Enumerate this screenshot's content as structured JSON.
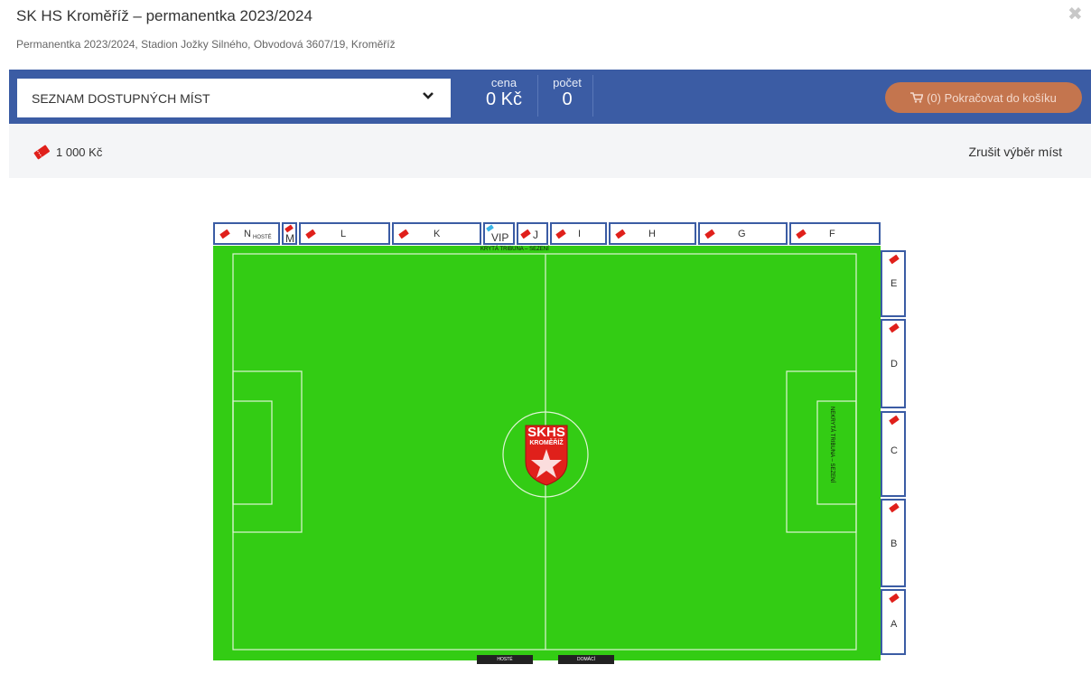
{
  "header": {
    "title": "SK HS Kroměříž – permanentka 2023/2024",
    "subtitle": "Permanentka 2023/2024, Stadion Jožky Silného, Obvodová 3607/19, Kroměříž",
    "close_icon": "close-icon"
  },
  "toolbar": {
    "select_value": "SEZNAM DOSTUPNÝCH MÍST",
    "price_label": "cena",
    "price_value": "0 Kč",
    "count_label": "počet",
    "count_value": "0",
    "cart_label": "(0) Pokračovat do košíku",
    "accent": "#3b5ca4",
    "cart_color": "#c4754e"
  },
  "price_strip": {
    "price": "1 000 Kč",
    "cancel_label": "Zrušit výběr míst",
    "ticket_color": "#e0201b"
  },
  "stadium": {
    "top_sectors": [
      "N",
      "M",
      "L",
      "K",
      "VIP",
      "J",
      "I",
      "H",
      "G",
      "F"
    ],
    "n_sub": "HOSTÉ",
    "right_sectors": [
      "E",
      "D",
      "C",
      "B",
      "A"
    ],
    "top_stand": "KRYTÁ TRIBUNA – SEZENÍ",
    "right_stand": "NEKRYTÁ TRIBUNA – SEZENÍ",
    "logo_line1": "SKHS",
    "logo_line2": "KROMĚŘÍŽ",
    "bottom_left": "HOSTÉ",
    "bottom_right": "DOMÁCÍ",
    "pitch_color": "#33cc14"
  }
}
